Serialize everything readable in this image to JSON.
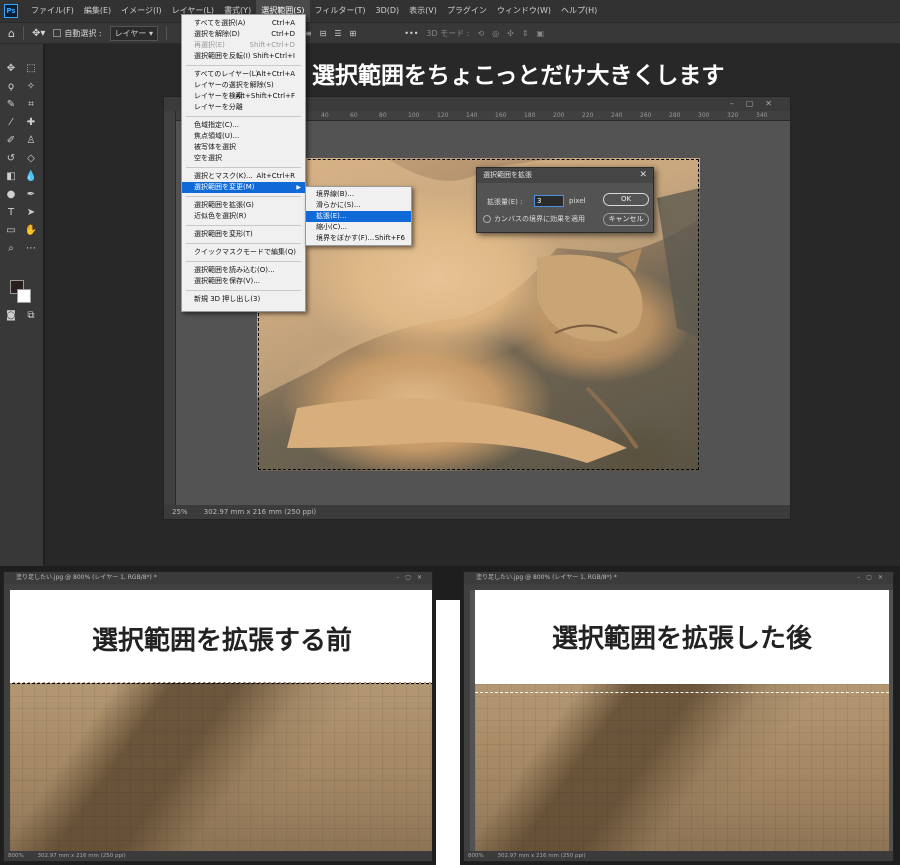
{
  "app": {
    "logo": "Ps",
    "menus": [
      "ファイル(F)",
      "編集(E)",
      "イメージ(I)",
      "レイヤー(L)",
      "書式(Y)",
      "選択範囲(S)",
      "フィルター(T)",
      "3D(D)",
      "表示(V)",
      "プラグイン",
      "ウィンドウ(W)",
      "ヘルプ(H)"
    ],
    "active_menu_index": 5
  },
  "options_bar": {
    "auto_select_label": "自動選択 :",
    "auto_select_target": "レイヤー",
    "mode_label": "3D モード :"
  },
  "headline": "選択範囲をちょこっとだけ大きくします",
  "document": {
    "tab_title": "",
    "ruler_ticks": [
      "40",
      "60",
      "80",
      "100",
      "120",
      "140",
      "160",
      "180",
      "200",
      "220",
      "240",
      "260",
      "280",
      "300",
      "320",
      "340"
    ],
    "zoom": "25%",
    "dimensions": "302.97 mm x 216 mm (250 ppi)"
  },
  "select_menu": {
    "groups": [
      [
        {
          "label": "すべてを選択(A)",
          "shortcut": "Ctrl+A",
          "disabled": false
        },
        {
          "label": "選択を解除(D)",
          "shortcut": "Ctrl+D",
          "disabled": false
        },
        {
          "label": "再選択(E)",
          "shortcut": "Shift+Ctrl+D",
          "disabled": true
        },
        {
          "label": "選択範囲を反転(I)",
          "shortcut": "Shift+Ctrl+I",
          "disabled": false
        }
      ],
      [
        {
          "label": "すべてのレイヤー(L)",
          "shortcut": "Alt+Ctrl+A",
          "disabled": false
        },
        {
          "label": "レイヤーの選択を解除(S)",
          "shortcut": "",
          "disabled": false
        },
        {
          "label": "レイヤーを検索",
          "shortcut": "Alt+Shift+Ctrl+F",
          "disabled": false
        },
        {
          "label": "レイヤーを分離",
          "shortcut": "",
          "disabled": false
        }
      ],
      [
        {
          "label": "色域指定(C)...",
          "shortcut": "",
          "disabled": false
        },
        {
          "label": "焦点領域(U)...",
          "shortcut": "",
          "disabled": false
        },
        {
          "label": "被写体を選択",
          "shortcut": "",
          "disabled": false
        },
        {
          "label": "空を選択",
          "shortcut": "",
          "disabled": false
        }
      ],
      [
        {
          "label": "選択とマスク(K)...",
          "shortcut": "Alt+Ctrl+R",
          "disabled": false
        },
        {
          "label": "選択範囲を変更(M)",
          "shortcut": "",
          "disabled": false,
          "highlighted": true,
          "submenu": true
        }
      ],
      [
        {
          "label": "選択範囲を拡張(G)",
          "shortcut": "",
          "disabled": false
        },
        {
          "label": "近似色を選択(R)",
          "shortcut": "",
          "disabled": false
        }
      ],
      [
        {
          "label": "選択範囲を変形(T)",
          "shortcut": "",
          "disabled": false
        }
      ],
      [
        {
          "label": "クイックマスクモードで編集(Q)",
          "shortcut": "",
          "disabled": false
        }
      ],
      [
        {
          "label": "選択範囲を読み込む(O)...",
          "shortcut": "",
          "disabled": false
        },
        {
          "label": "選択範囲を保存(V)...",
          "shortcut": "",
          "disabled": false
        }
      ],
      [
        {
          "label": "新規 3D 押し出し(3)",
          "shortcut": "",
          "disabled": false
        }
      ]
    ]
  },
  "modify_submenu": {
    "items": [
      {
        "label": "境界線(B)...",
        "shortcut": ""
      },
      {
        "label": "滑らかに(S)...",
        "shortcut": ""
      },
      {
        "label": "拡張(E)...",
        "shortcut": "",
        "highlighted": true
      },
      {
        "label": "縮小(C)...",
        "shortcut": ""
      },
      {
        "label": "境界をぼかす(F)...",
        "shortcut": "Shift+F6"
      }
    ]
  },
  "expand_dialog": {
    "title": "選択範囲を拡張",
    "amount_label": "拡張量(E) :",
    "amount_value": "3",
    "unit": "pixel",
    "canvas_checkbox_label": "カンバスの境界に効果を適用",
    "ok_label": "OK",
    "cancel_label": "キャンセル"
  },
  "before_panel": {
    "tab_title": "塗り足したい.jpg @ 800% (レイヤー 1, RGB/8*) *",
    "caption": "選択範囲を拡張する前",
    "zoom": "800%",
    "dimensions": "302.97 mm x 216 mm (250 ppi)"
  },
  "after_panel": {
    "tab_title": "塗り足したい.jpg @ 800% (レイヤー 1, RGB/8*) *",
    "caption": "選択範囲を拡張した後",
    "zoom": "800%",
    "dimensions": "302.97 mm x 216 mm (250 ppi)"
  }
}
